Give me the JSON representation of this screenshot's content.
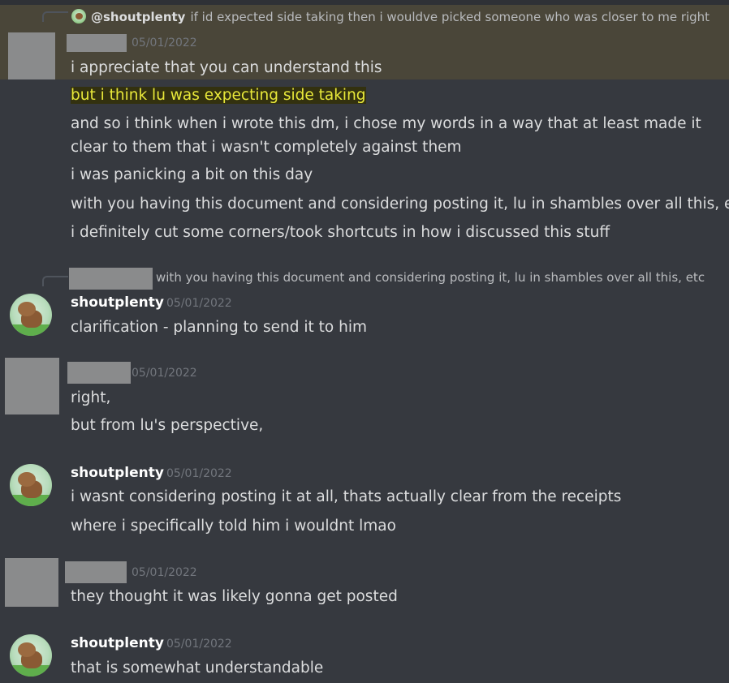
{
  "reply1": {
    "mention": "@shoutplenty",
    "text": "if id expected side taking then i wouldve picked someone who was closer to me right"
  },
  "group1": {
    "timestamp": "05/01/2022",
    "messages": [
      "i appreciate that you can understand this",
      "but i think lu was expecting side taking",
      "and so i think when i wrote this dm, i chose my words in a way that at least made it clear to them that i wasn't completely against them",
      "i was panicking a bit on this day",
      "with you having this document and considering posting it, lu in shambles over all this, etc",
      "i definitely cut some corners/took shortcuts in how i discussed this stuff"
    ]
  },
  "reply2": {
    "text": "with you having this document and considering posting it, lu in shambles over all this, etc"
  },
  "group2": {
    "username": "shoutplenty",
    "timestamp": "05/01/2022",
    "messages": [
      "clarification - planning to send it to him"
    ]
  },
  "group3": {
    "timestamp": "05/01/2022",
    "messages": [
      "right,",
      "but from lu's perspective,"
    ]
  },
  "group4": {
    "username": "shoutplenty",
    "timestamp": "05/01/2022",
    "messages": [
      "i wasnt considering posting it at all, thats actually clear from the receipts",
      "where i specifically told him i wouldnt lmao"
    ]
  },
  "group5": {
    "timestamp": "05/01/2022",
    "messages": [
      "they thought it was likely gonna get posted"
    ]
  },
  "group6": {
    "username": "shoutplenty",
    "timestamp": "05/01/2022",
    "messages": [
      "that is somewhat understandable"
    ]
  },
  "colors": {
    "background": "#36393f",
    "highlight_row": "#4a4639",
    "highlight_text": "#e8e83a",
    "text": "#dcddde",
    "muted": "#72767d",
    "redaction": "#8a8b8c"
  }
}
